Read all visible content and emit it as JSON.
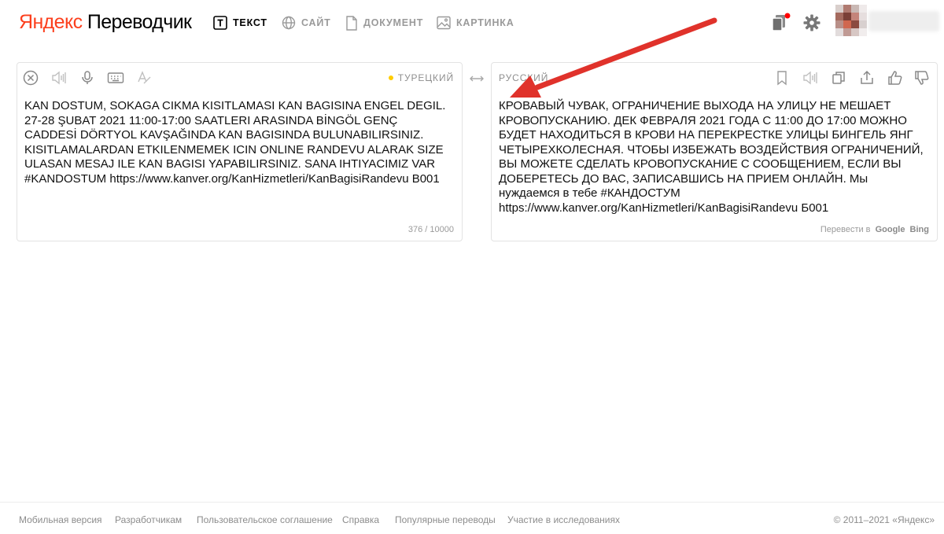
{
  "header": {
    "logo_brand": "Яндекс",
    "logo_product": "Переводчик",
    "nav": [
      {
        "label": "ТЕКСТ",
        "icon": "text-icon",
        "active": true
      },
      {
        "label": "САЙТ",
        "icon": "globe-icon",
        "active": false
      },
      {
        "label": "ДОКУМЕНТ",
        "icon": "document-icon",
        "active": false
      },
      {
        "label": "КАРТИНКА",
        "icon": "image-icon",
        "active": false
      }
    ],
    "icons": [
      "collections-icon",
      "settings-icon"
    ],
    "notification_color": "#ff0000"
  },
  "source": {
    "language": "ТУРЕЦКИЙ",
    "text": "KAN DOSTUM, SOKAGA CIKMA KISITLAMASI KAN BAGISINA ENGEL DEGIL.\n27-28 ŞUBAT 2021 11:00-17:00 SAATLERI ARASINDA BİNGÖL GENÇ\nCADDESİ DÖRTYOL KAVŞAĞINDA KAN BAGISINDA BULUNABILIRSINIZ.\nKISITLAMALARDAN ETKILENMEMEK ICIN ONLINE RANDEVU ALARAK SIZE\nULASAN MESAJ ILE KAN BAGISI YAPABILIRSINIZ. SANA IHTIYACIMIZ VAR\n#KANDOSTUM https://www.kanver.org/KanHizmetleri/KanBagisiRandevu B001",
    "counter": "376 / 10000",
    "tools": [
      "clear-icon",
      "speaker-icon",
      "microphone-icon",
      "keyboard-icon",
      "spellcheck-icon"
    ],
    "language_dot_color": "#ffcc00"
  },
  "target": {
    "language": "РУССКИЙ",
    "text": "КРОВАВЫЙ ЧУВАК, ОГРАНИЧЕНИЕ ВЫХОДА НА УЛИЦУ НЕ МЕШАЕТ\nКРОВОПУСКАНИЮ. ДЕК ФЕВРАЛЯ 2021 ГОДА С 11:00 ДО 17:00 МОЖНО\nБУДЕТ НАХОДИТЬСЯ В КРОВИ НА ПЕРЕКРЕСТКЕ УЛИЦЫ БИНГЕЛЬ ЯНГ\nЧЕТЫРЕХКОЛЕСНАЯ. ЧТОБЫ ИЗБЕЖАТЬ ВОЗДЕЙСТВИЯ ОГРАНИЧЕНИЙ,\nВЫ МОЖЕТЕ СДЕЛАТЬ КРОВОПУСКАНИЕ С СООБЩЕНИЕМ, ЕСЛИ ВЫ\nДОБЕРЕТЕСЬ ДО ВАС, ЗАПИСАВШИСЬ НА ПРИЕМ ОНЛАЙН. Мы\nнуждаемся в тебе #КАНДОСТУМ\nhttps://www.kanver.org/KanHizmetleri/KanBagisiRandevu Б001",
    "engine_prefix": "Перевести в",
    "engines": [
      "Google",
      "Bing"
    ],
    "tools": [
      "bookmark-icon",
      "speaker-icon",
      "copy-icon",
      "share-icon",
      "thumbs-up-icon",
      "thumbs-down-icon"
    ]
  },
  "annotation": {
    "arrow_color": "#e0322b"
  },
  "footer": {
    "links": [
      "Мобильная версия",
      "Разработчикам",
      "Пользовательское соглашение",
      "Справка",
      "Популярные переводы",
      "Участие в исследованиях"
    ],
    "copyright": "© 2011–2021 «Яндекс»"
  }
}
